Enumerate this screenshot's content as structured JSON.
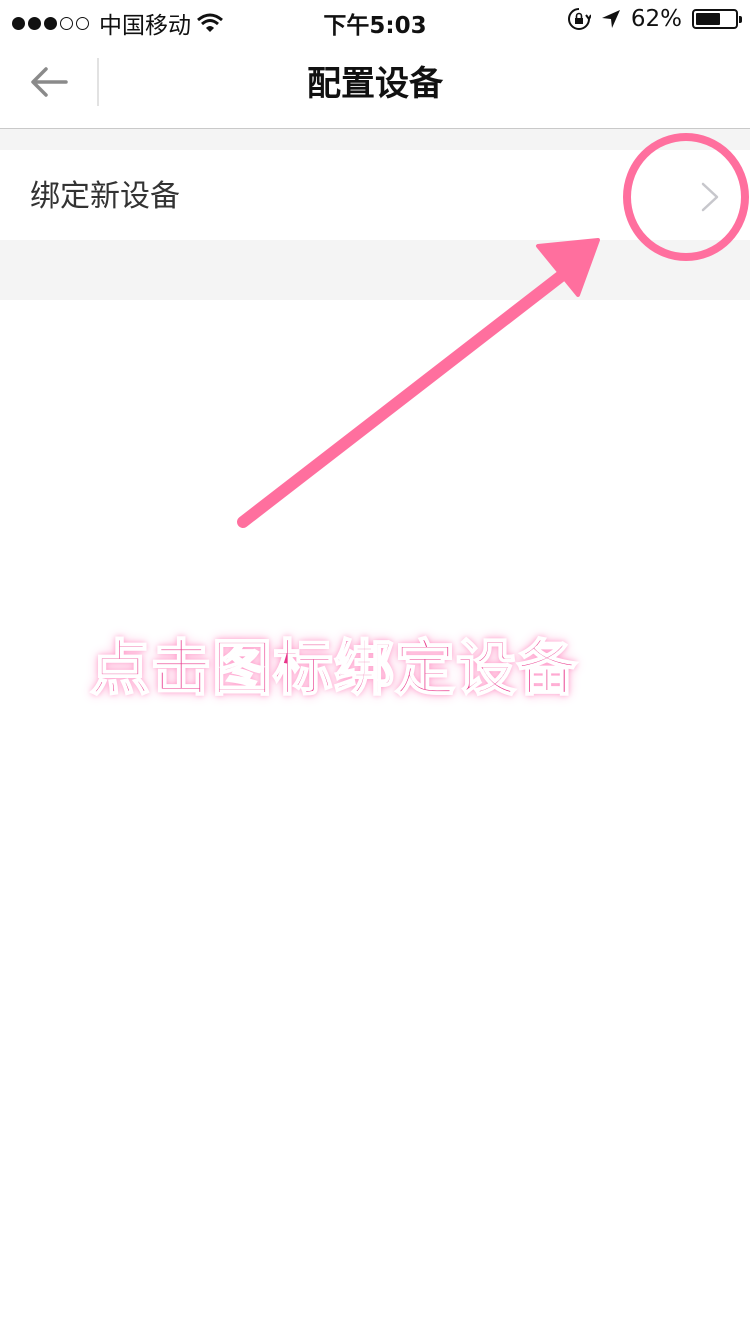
{
  "status_bar": {
    "carrier": "中国移动",
    "time": "下午5:03",
    "battery_percent_label": "62%",
    "battery_level": 0.62
  },
  "nav": {
    "title": "配置设备"
  },
  "list": {
    "items": [
      {
        "label": "绑定新设备"
      }
    ]
  },
  "annotation": {
    "text": "点击图标绑定设备",
    "color": "#ff6f9e"
  },
  "colors": {
    "section_gray": "#f4f4f4",
    "chevron": "#c7c7cc",
    "annotation_text": "#e8358a"
  },
  "icons": {
    "back": "arrow-left-icon",
    "row_chevron": "chevron-right-icon",
    "wifi": "wifi-icon",
    "rotation_lock": "rotation-lock-icon",
    "location": "location-arrow-icon",
    "battery": "battery-icon"
  }
}
